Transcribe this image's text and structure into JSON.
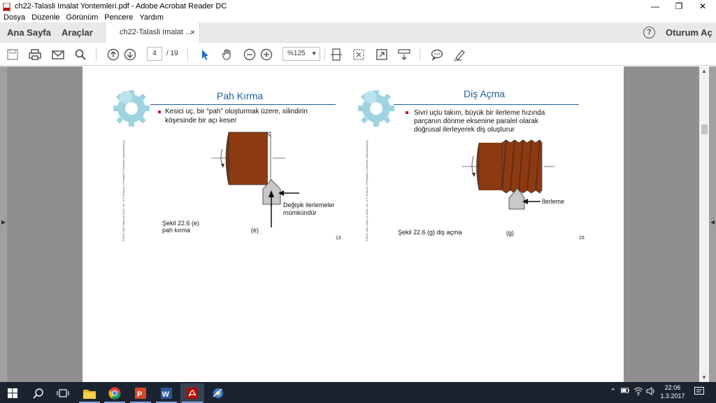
{
  "window": {
    "title": "ch22-Talasli Imalat Yontemleri.pdf - Adobe Acrobat Reader DC",
    "minimize": "—",
    "maximize": "❐",
    "close": "✕"
  },
  "menu": [
    "Dosya",
    "Düzenle",
    "Görünüm",
    "Pencere",
    "Yardım"
  ],
  "nav": {
    "home": "Ana Sayfa",
    "tools": "Araçlar",
    "doc_tab": "ch22-Talasli Imalat ...",
    "doc_tab_close": "×",
    "help": "?",
    "signin": "Oturum Aç"
  },
  "toolbar": {
    "page_current": "4",
    "page_total": "/ 19",
    "zoom": "%125",
    "icons": [
      "save-icon",
      "print-icon",
      "email-icon",
      "search-icon",
      "page-up-icon",
      "page-down-icon",
      "select-cursor-icon",
      "hand-icon",
      "zoom-out-icon",
      "zoom-in-icon",
      "fit-page-icon",
      "full-screen-icon",
      "rotate-icon",
      "scroll-mode-icon",
      "comment-icon",
      "highlight-icon"
    ]
  },
  "slides": [
    {
      "title": "Pah Kırma",
      "bullet_line1": "Kesici uç, bir “pah” oluşturmak üzere, silindirin",
      "bullet_line2": "köşesinde bir açı keser",
      "callout_line1": "Değişik ilerlemeler",
      "callout_line2": "mümkündür",
      "caption_line1": "Şekil 22.6 (e)",
      "caption_line2": "pah kırma",
      "fig_label": "(e)",
      "page_number": "13",
      "vertical_note": "©2010 John Wiley & Sons, Inc. M P Groover, Principles of Modern Manufacturing 4/e SI Version"
    },
    {
      "title": "Diş Açma",
      "bullet_line1": "Sivri uçlu takım, büyük bir ilerleme hızında",
      "bullet_line2": "parçanın dönme eksenine paralel olarak",
      "bullet_line3": "doğrusal  ilerleyerek diş oluşturur",
      "callout": "İlerleme",
      "caption": "Şekil 22.6 (g) diş açma",
      "fig_label": "(g)",
      "page_number": "15",
      "vertical_note": "©2010 John Wiley & Sons, Inc. M P Groover, Principles of Modern Manufacturing 4/e SI Version"
    }
  ],
  "taskbar": {
    "time": "22:06",
    "date": "1.3.2017",
    "icons": [
      "windows-start-icon",
      "search-icon",
      "task-view-icon",
      "file-explorer-icon",
      "chrome-icon",
      "powerpoint-icon",
      "word-icon",
      "acrobat-icon",
      "app-icon"
    ]
  },
  "colors": {
    "accent_blue": "#1f5f9e",
    "bullet_red": "#c0144a",
    "workpiece": "#8b3a12",
    "gear": "#9fd3e0",
    "taskbar": "#1c2330"
  }
}
